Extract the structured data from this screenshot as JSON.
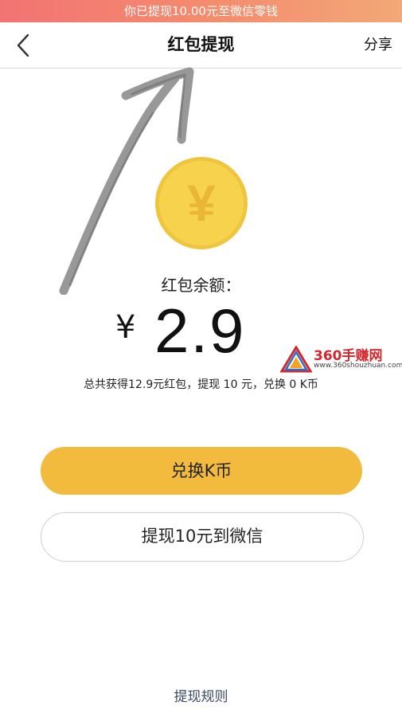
{
  "banner": {
    "text": "你已提现10.00元至微信零钱"
  },
  "navbar": {
    "title": "红包提现",
    "share_label": "分享",
    "back_icon": "chevron-left-icon"
  },
  "coin": {
    "symbol": "¥",
    "icon": "yuan-coin-icon"
  },
  "balance": {
    "label": "红包余额：",
    "currency": "¥",
    "amount": "2.9"
  },
  "watermark": {
    "title": "360手赚网",
    "subtitle": "www.360shouzhuan.com"
  },
  "summary": {
    "text": "总共获得12.9元红包，提现 10 元，兑换 0 K币"
  },
  "actions": {
    "exchange_label": "兑换K币",
    "withdraw_label": "提现10元到微信"
  },
  "footer": {
    "rules_label": "提现规则"
  },
  "colors": {
    "banner_start": "#f27373",
    "banner_end": "#f2a877",
    "primary_button": "#f2bb3e",
    "coin_fill": "#f7d34d",
    "coin_symbol": "#eab638",
    "link": "#3a4a66"
  }
}
